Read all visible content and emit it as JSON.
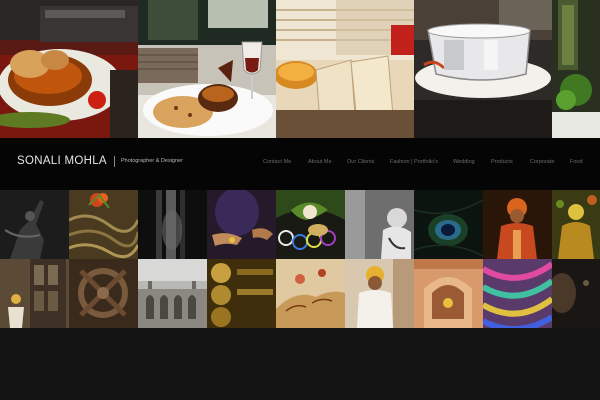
{
  "site": {
    "title": "SONALI MOHLA",
    "tagline": "Photographer & Designer"
  },
  "nav": {
    "items": [
      {
        "label": "Contact Me",
        "name": "nav-item-contact-me"
      },
      {
        "label": "About Me",
        "name": "nav-item-about-me"
      },
      {
        "label": "Our Clients",
        "name": "nav-item-our-clients"
      },
      {
        "label": "Fashion | Portfolio's",
        "name": "nav-item-fashion-portfolios"
      },
      {
        "label": "Wedding",
        "name": "nav-item-wedding"
      },
      {
        "label": "Products",
        "name": "nav-item-products"
      },
      {
        "label": "Corporate",
        "name": "nav-item-corporate"
      },
      {
        "label": "Food",
        "name": "nav-item-food"
      }
    ]
  },
  "hero": {
    "images": [
      {
        "name": "hero-image-curry-bowl",
        "subject": "curry bowl with bread"
      },
      {
        "name": "hero-image-flatbread-wine",
        "subject": "flatbread, dal and wine glass"
      },
      {
        "name": "hero-image-wraps",
        "subject": "rolled wraps on plate"
      },
      {
        "name": "hero-image-steel-cup",
        "subject": "steel cup on saucer"
      },
      {
        "name": "hero-image-greens",
        "subject": "greens and bottle"
      }
    ]
  },
  "gallery": {
    "row1": [
      {
        "name": "thumb-dancer-bw"
      },
      {
        "name": "thumb-noodles-garnish"
      },
      {
        "name": "thumb-curtain-dark"
      },
      {
        "name": "thumb-hands-purple"
      },
      {
        "name": "thumb-bangles-plate"
      },
      {
        "name": "thumb-woman-bw"
      },
      {
        "name": "thumb-peacock-feather"
      },
      {
        "name": "thumb-turban-man"
      },
      {
        "name": "thumb-festive-figure"
      }
    ],
    "row2": [
      {
        "name": "thumb-old-doorway"
      },
      {
        "name": "thumb-carved-panel"
      },
      {
        "name": "thumb-palace-facade"
      },
      {
        "name": "thumb-golden-objects"
      },
      {
        "name": "thumb-mehendi-hand"
      },
      {
        "name": "thumb-rajasthani-man"
      },
      {
        "name": "thumb-haveli-window"
      },
      {
        "name": "thumb-colorful-textile"
      },
      {
        "name": "thumb-dark-portrait"
      }
    ]
  }
}
